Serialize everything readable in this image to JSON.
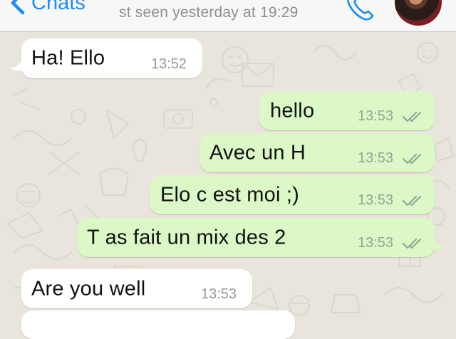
{
  "header": {
    "back_label": "Chats",
    "status": "st seen yesterday at 19:29",
    "call_icon": "phone-icon",
    "avatar_icon": "contact-avatar"
  },
  "messages": [
    {
      "direction": "in",
      "text": "Ha! Ello",
      "time": "13:52"
    },
    {
      "direction": "out",
      "text": "hello",
      "time": "13:53",
      "read": true
    },
    {
      "direction": "out",
      "text": "Avec un H",
      "time": "13:53",
      "read": true
    },
    {
      "direction": "out",
      "text": "Elo c est moi ;)",
      "time": "13:53",
      "read": true
    },
    {
      "direction": "out",
      "text": "T as fait un mix des 2",
      "time": "13:53",
      "read": true
    },
    {
      "direction": "in",
      "text": "Are you well",
      "time": "13:53"
    },
    {
      "direction": "in",
      "text": "",
      "time": ""
    }
  ],
  "colors": {
    "accent": "#1e8cf0",
    "outgoing_bubble": "#dcf8c6",
    "incoming_bubble": "#ffffff",
    "wallpaper": "#e9e5dd",
    "read_ticks": "#8fa996"
  }
}
